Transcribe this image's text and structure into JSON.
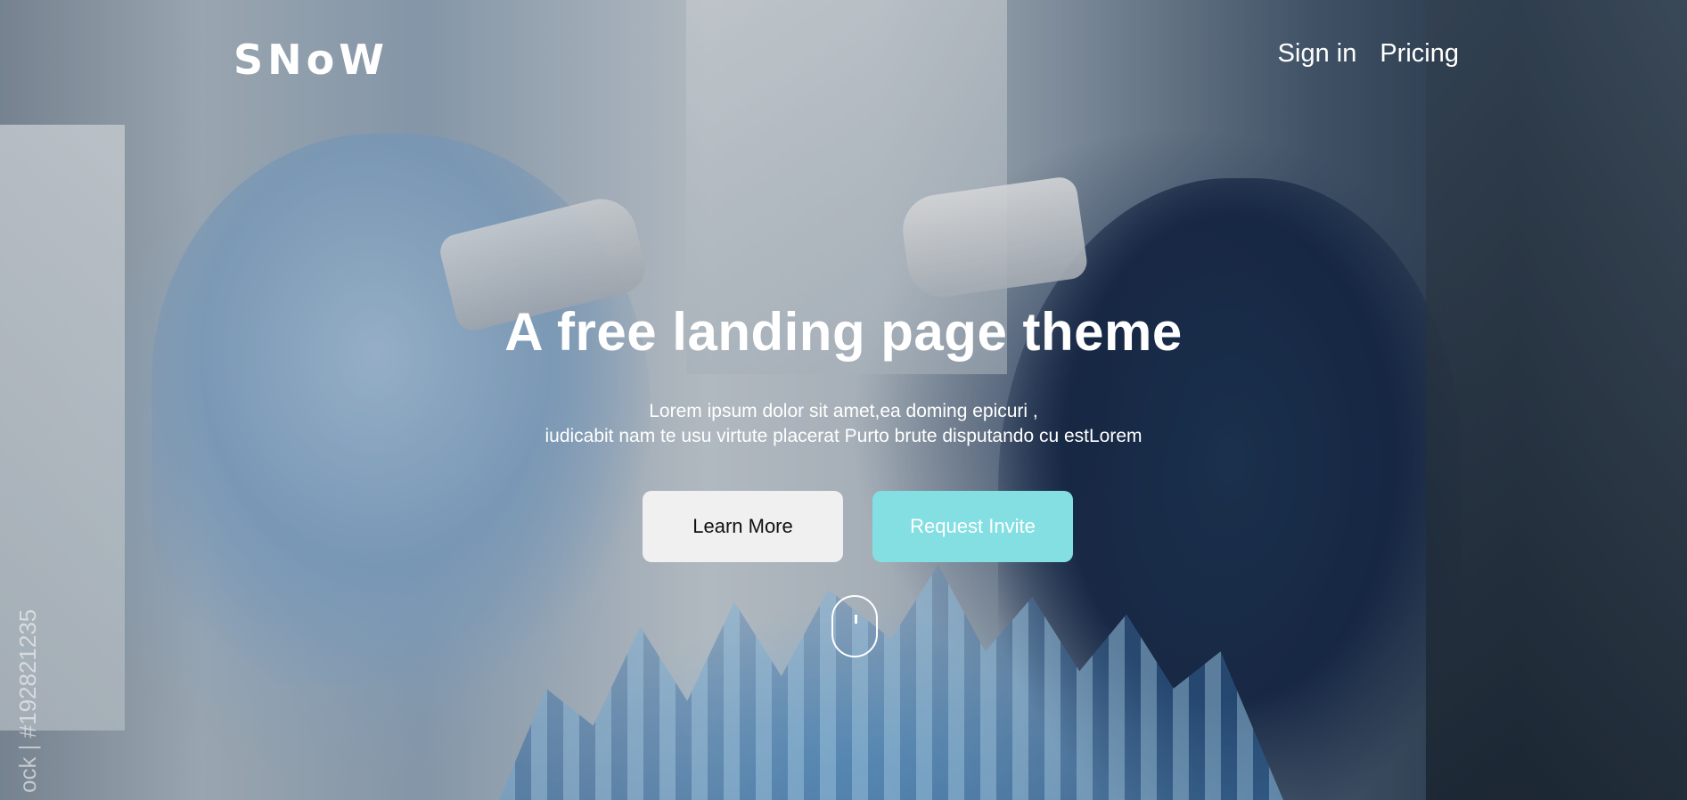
{
  "brand": {
    "logo_text": "SNoW"
  },
  "nav": {
    "items": [
      {
        "label": "Sign in"
      },
      {
        "label": "Pricing"
      }
    ]
  },
  "hero": {
    "title": "A free landing page theme",
    "subtitle_line1": "Lorem ipsum dolor sit amet,ea doming epicuri ,",
    "subtitle_line2": "iudicabit nam te usu virtute placerat Purto brute disputando cu estLorem",
    "buttons": {
      "primary_label": "Learn More",
      "secondary_label": "Request Invite"
    },
    "scroll_icon": "mouse-scroll-icon"
  },
  "watermark": {
    "text": "ock | #192821235"
  },
  "colors": {
    "accent": "#84dfe2",
    "button_light": "#f0f0f0",
    "text": "#ffffff"
  }
}
